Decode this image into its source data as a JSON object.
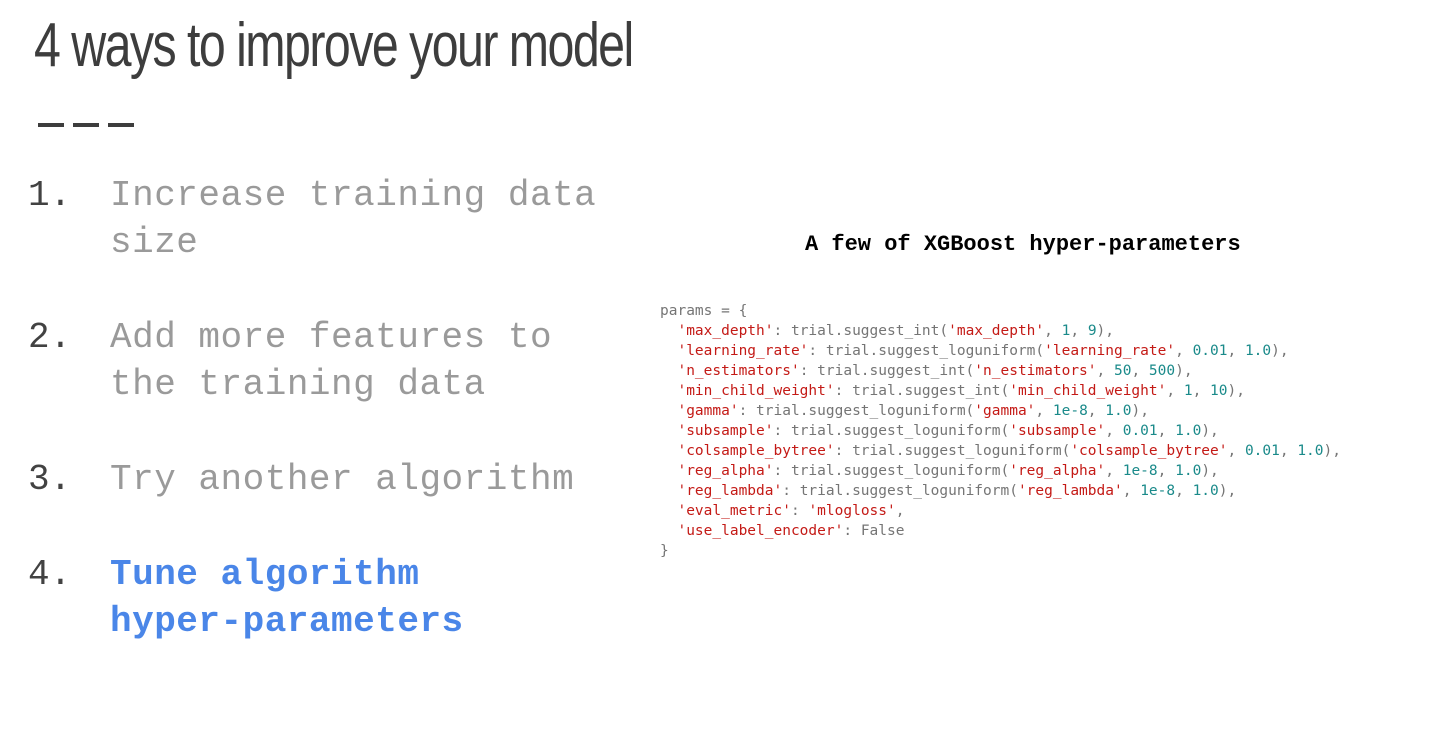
{
  "title": "4 ways to improve your model",
  "list": [
    {
      "number": "1.",
      "lines": [
        "Increase training data",
        "size"
      ],
      "active": false
    },
    {
      "number": "2.",
      "lines": [
        "Add more features to",
        "the training data"
      ],
      "active": false
    },
    {
      "number": "3.",
      "lines": [
        "Try another algorithm"
      ],
      "active": false
    },
    {
      "number": "4.",
      "lines": [
        "Tune algorithm",
        "hyper-parameters"
      ],
      "active": true
    }
  ],
  "code_heading": "A few of XGBoost hyper-parameters",
  "code": {
    "open": "params = {",
    "close": "}",
    "lines": [
      {
        "key": "'max_depth'",
        "call": "trial.suggest_int(",
        "name": "'max_depth'",
        "args": [
          "1",
          "9"
        ]
      },
      {
        "key": "'learning_rate'",
        "call": "trial.suggest_loguniform(",
        "name": "'learning_rate'",
        "args": [
          "0.01",
          "1.0"
        ]
      },
      {
        "key": "'n_estimators'",
        "call": "trial.suggest_int(",
        "name": "'n_estimators'",
        "args": [
          "50",
          "500"
        ]
      },
      {
        "key": "'min_child_weight'",
        "call": "trial.suggest_int(",
        "name": "'min_child_weight'",
        "args": [
          "1",
          "10"
        ]
      },
      {
        "key": "'gamma'",
        "call": "trial.suggest_loguniform(",
        "name": "'gamma'",
        "args": [
          "1e-8",
          "1.0"
        ]
      },
      {
        "key": "'subsample'",
        "call": "trial.suggest_loguniform(",
        "name": "'subsample'",
        "args": [
          "0.01",
          "1.0"
        ]
      },
      {
        "key": "'colsample_bytree'",
        "call": "trial.suggest_loguniform(",
        "name": "'colsample_bytree'",
        "args": [
          "0.01",
          "1.0"
        ]
      },
      {
        "key": "'reg_alpha'",
        "call": "trial.suggest_loguniform(",
        "name": "'reg_alpha'",
        "args": [
          "1e-8",
          "1.0"
        ]
      },
      {
        "key": "'reg_lambda'",
        "call": "trial.suggest_loguniform(",
        "name": "'reg_lambda'",
        "args": [
          "1e-8",
          "1.0"
        ]
      },
      {
        "key": "'eval_metric'",
        "value": "'mlogloss'"
      },
      {
        "key": "'use_label_encoder'",
        "value": "False",
        "value_is_plain": true
      }
    ]
  },
  "colors": {
    "title": "#3d3d3d",
    "list_number": "#424242",
    "list_text": "#9a9a9a",
    "list_active": "#4a86e8",
    "code_string": "#c41a16",
    "code_number": "#1a8a8a",
    "code_plain": "#757575"
  }
}
